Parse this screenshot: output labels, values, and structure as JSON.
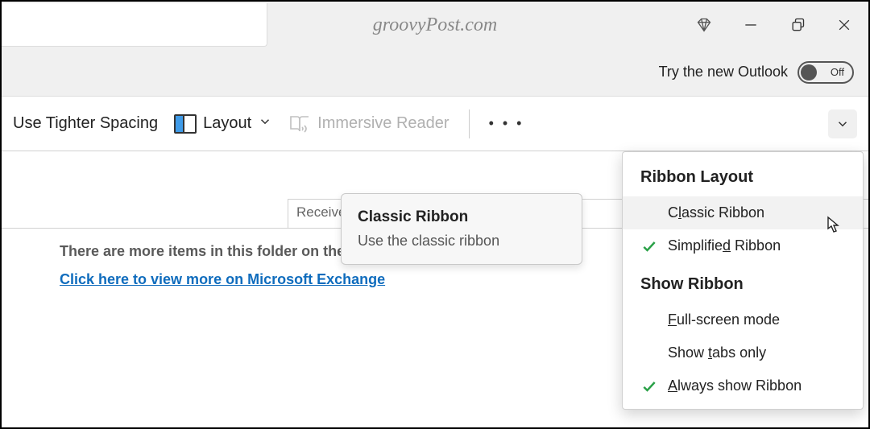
{
  "watermark": "groovyPost.com",
  "try_new": {
    "label": "Try the new Outlook",
    "toggle_text": "Off"
  },
  "ribbon": {
    "tighter_spacing": "Use Tighter Spacing",
    "layout": "Layout",
    "immersive_reader": "Immersive Reader"
  },
  "received_header": "Receive",
  "info": {
    "message": "There are more items in this folder on the server",
    "link": "Click here to view more on Microsoft Exchange"
  },
  "tooltip": {
    "title": "Classic Ribbon",
    "description": "Use the classic ribbon"
  },
  "menu": {
    "heading1": "Ribbon Layout",
    "items1": [
      {
        "label_pre": "C",
        "label_ul": "l",
        "label_post": "assic Ribbon",
        "checked": false,
        "hover": true
      },
      {
        "label_pre": "Simplifie",
        "label_ul": "d",
        "label_post": " Ribbon",
        "checked": true,
        "hover": false
      }
    ],
    "heading2": "Show Ribbon",
    "items2": [
      {
        "label_pre": "",
        "label_ul": "F",
        "label_post": "ull-screen mode",
        "checked": false
      },
      {
        "label_pre": "Show ",
        "label_ul": "t",
        "label_post": "abs only",
        "checked": false
      },
      {
        "label_pre": "",
        "label_ul": "A",
        "label_post": "lways show Ribbon",
        "checked": true
      }
    ]
  }
}
